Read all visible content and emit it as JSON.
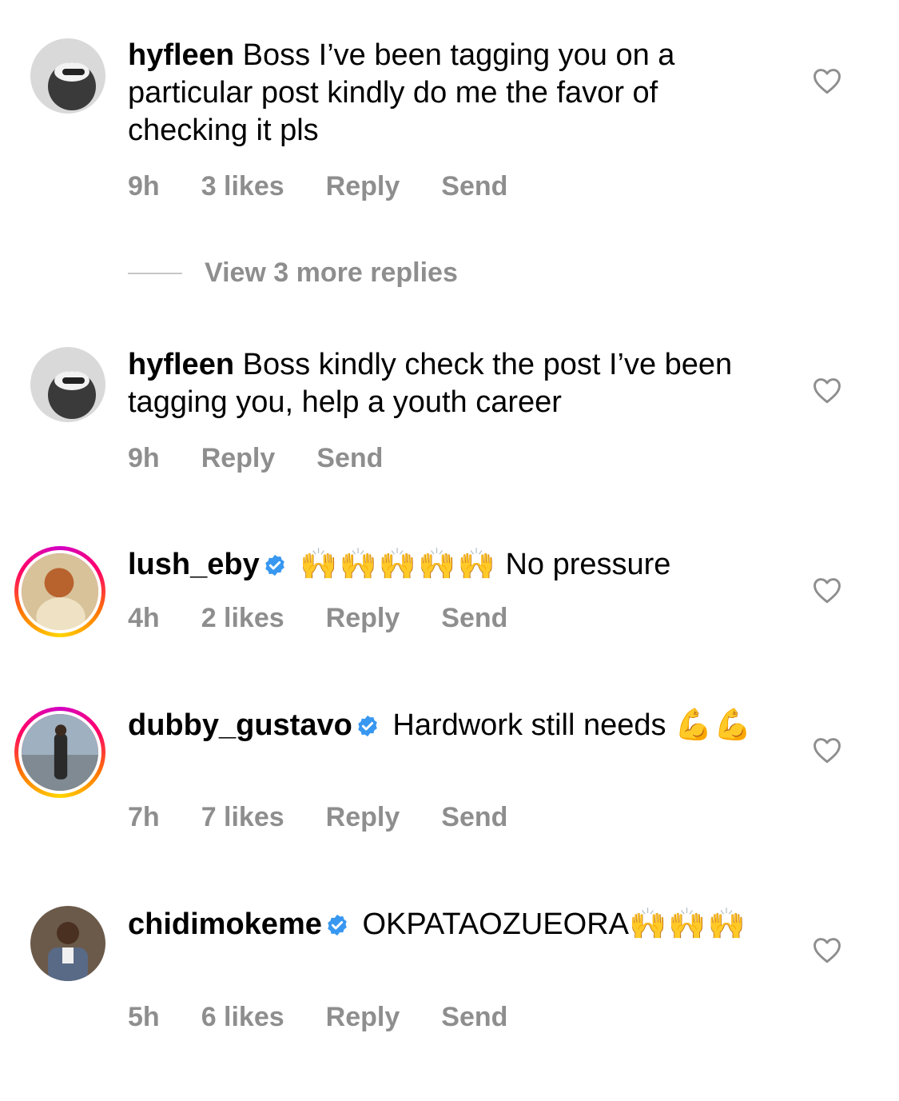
{
  "comments": [
    {
      "username": "hyfleen",
      "verified": false,
      "text": "Boss I’ve been tagging you on a particular post kindly do me the favor of checking it pls",
      "emoji": "",
      "time": "9h",
      "likes": "3 likes",
      "reply": "Reply",
      "send": "Send",
      "story_ring": false
    },
    {
      "username": "hyfleen",
      "verified": false,
      "text": "Boss kindly check the post I’ve been tagging you, help a youth career",
      "emoji": "",
      "time": "9h",
      "likes": "",
      "reply": "Reply",
      "send": "Send",
      "story_ring": false
    },
    {
      "username": "lush_eby",
      "verified": true,
      "text": "No pressure",
      "emoji": "🙌🙌🙌🙌🙌",
      "time": "4h",
      "likes": "2 likes",
      "reply": "Reply",
      "send": "Send",
      "story_ring": true
    },
    {
      "username": "dubby_gustavo",
      "verified": true,
      "text": "Hardwork still needs",
      "emoji": "💪💪",
      "time": "7h",
      "likes": "7 likes",
      "reply": "Reply",
      "send": "Send",
      "story_ring": true
    },
    {
      "username": "chidimokeme",
      "verified": true,
      "text": "OKPATAOZUEORA",
      "emoji": "🙌🙌🙌",
      "time": "5h",
      "likes": "6 likes",
      "reply": "Reply",
      "send": "Send",
      "story_ring": false
    }
  ],
  "view_more": "View 3 more replies",
  "icons": {
    "like": "heart-outline-icon",
    "verified": "verified-badge-icon"
  },
  "colors": {
    "verified": "#3897f0",
    "meta": "#8e8e8e",
    "heart_stroke": "#8e8e8e"
  }
}
